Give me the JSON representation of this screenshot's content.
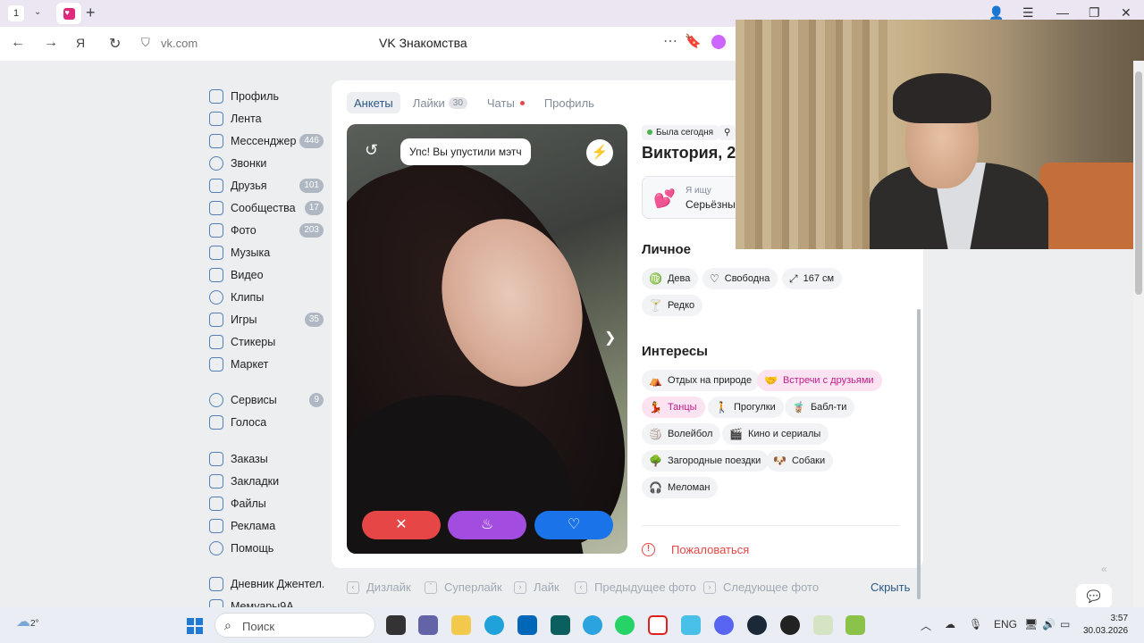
{
  "browser": {
    "tab_number": "1",
    "url": "vk.com",
    "page_title": "VK Знакомства"
  },
  "sidebar": {
    "items": [
      {
        "label": "Профиль",
        "badge": ""
      },
      {
        "label": "Лента",
        "badge": ""
      },
      {
        "label": "Мессенджер",
        "badge": "446"
      },
      {
        "label": "Звонки",
        "badge": ""
      },
      {
        "label": "Друзья",
        "badge": "101"
      },
      {
        "label": "Сообщества",
        "badge": "17"
      },
      {
        "label": "Фото",
        "badge": "203"
      },
      {
        "label": "Музыка",
        "badge": ""
      },
      {
        "label": "Видео",
        "badge": ""
      },
      {
        "label": "Клипы",
        "badge": ""
      },
      {
        "label": "Игры",
        "badge": "35"
      },
      {
        "label": "Стикеры",
        "badge": ""
      },
      {
        "label": "Маркет",
        "badge": ""
      },
      {
        "label": "Сервисы",
        "badge": "9"
      },
      {
        "label": "Голоса",
        "badge": ""
      },
      {
        "label": "Заказы",
        "badge": ""
      },
      {
        "label": "Закладки",
        "badge": ""
      },
      {
        "label": "Файлы",
        "badge": ""
      },
      {
        "label": "Реклама",
        "badge": ""
      },
      {
        "label": "Помощь",
        "badge": ""
      },
      {
        "label": "Дневник Джентел...",
        "badge": ""
      },
      {
        "label": "Мемуары9А",
        "badge": ""
      }
    ]
  },
  "dating": {
    "tabs": {
      "ankety": "Анкеты",
      "likes": "Лайки",
      "likes_count": "30",
      "chats": "Чаты",
      "profile": "Профиль"
    },
    "photo": {
      "toast": "Упс! Вы упустили мэтч"
    },
    "profile": {
      "status": "Была сегодня",
      "name": "Виктория, 21",
      "seeking_label": "Я ищу",
      "seeking_value": "Серьёзные",
      "personal_title": "Личное",
      "personal": [
        {
          "icon": "♍",
          "label": "Дева"
        },
        {
          "icon": "♡",
          "label": "Свободна"
        },
        {
          "icon": "⤢",
          "label": "167 см"
        },
        {
          "icon": "🍸",
          "label": "Редко"
        }
      ],
      "interests_title": "Интересы",
      "interests": [
        {
          "icon": "⛺",
          "label": "Отдых на природе",
          "highlight": false
        },
        {
          "icon": "🤝",
          "label": "Встречи с друзьями",
          "highlight": true
        },
        {
          "icon": "💃",
          "label": "Танцы",
          "highlight": true
        },
        {
          "icon": "🚶",
          "label": "Прогулки",
          "highlight": false
        },
        {
          "icon": "🧋",
          "label": "Бабл-ти",
          "highlight": false
        },
        {
          "icon": "🏐",
          "label": "Волейбол",
          "highlight": false
        },
        {
          "icon": "🎬",
          "label": "Кино и сериалы",
          "highlight": false
        },
        {
          "icon": "🌳",
          "label": "Загородные поездки",
          "highlight": false
        },
        {
          "icon": "🐶",
          "label": "Собаки",
          "highlight": false
        },
        {
          "icon": "🎧",
          "label": "Меломан",
          "highlight": false
        }
      ],
      "report": "Пожаловаться"
    },
    "hints": {
      "dislike": "Дизлайк",
      "superlike": "Суперлайк",
      "like": "Лайк",
      "prev": "Предыдущее фото",
      "next": "Следующее фото",
      "hide": "Скрыть"
    }
  },
  "taskbar": {
    "weather": "2°",
    "search_placeholder": "Поиск",
    "lang": "ENG",
    "time": "3:57",
    "date": "30.03.2026"
  },
  "colors": {
    "accent": "#2a5885",
    "dislike": "#e64646",
    "superlike": "#a24de0",
    "like": "#1a73e8",
    "pink": "#e0297a"
  }
}
